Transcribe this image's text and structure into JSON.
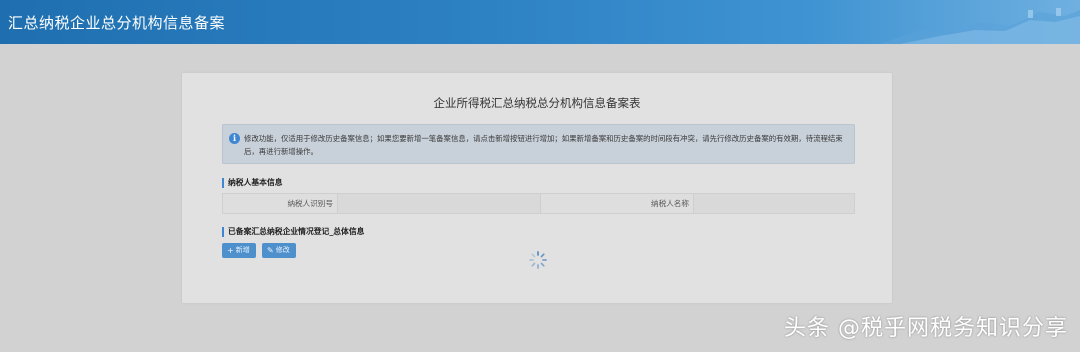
{
  "header": {
    "title": "汇总纳税企业总分机构信息备案"
  },
  "form": {
    "title": "企业所得税汇总纳税总分机构信息备案表",
    "notice": {
      "icon": "info-icon",
      "text": "修改功能，仅适用于修改历史备案信息；如果您要新增一笔备案信息，请点击新增按钮进行增加；如果新增备案和历史备案的时间段有冲突，请先行修改历史备案的有效期，待流程结束后，再进行新增操作。"
    },
    "taxpayer_section": {
      "label": "纳税人基本信息",
      "id_label": "纳税人识别号",
      "id_value": "",
      "name_label": "纳税人名称",
      "name_value": ""
    },
    "summary_section": {
      "label": "已备案汇总纳税企业情况登记_总体信息"
    },
    "buttons": {
      "add_label": "新增",
      "add_icon": "plus-icon",
      "edit_label": "修改",
      "edit_icon": "pencil-icon"
    }
  },
  "watermark": "头条 @税乎网税务知识分享",
  "colors": {
    "header_blue": "#2d82c4",
    "accent": "#3f86d3",
    "button": "#4e90cc",
    "background": "#d2d2d2"
  }
}
